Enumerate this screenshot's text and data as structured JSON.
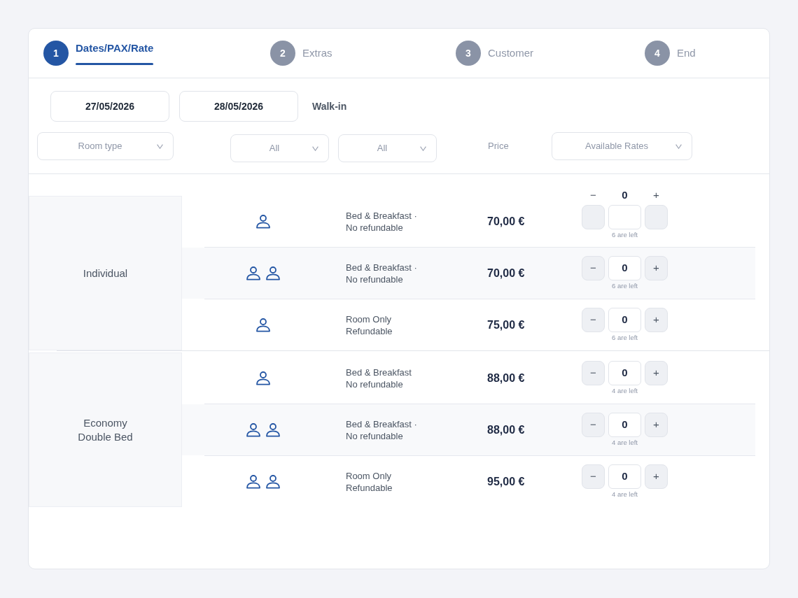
{
  "steps": [
    {
      "number": "1",
      "label": "Dates/PAX/Rate",
      "selected": true
    },
    {
      "number": "2",
      "label": "Extras",
      "selected": false
    },
    {
      "number": "3",
      "label": "Customer",
      "selected": false
    },
    {
      "number": "4",
      "label": "End",
      "selected": false
    }
  ],
  "search": {
    "arrival": "27/05/2026",
    "departure": "28/05/2026",
    "booking_type": "Walk-in",
    "room_type_dropdown": "Room type",
    "dropdown_2": "All",
    "dropdown_3": "All",
    "price_heading": "Price",
    "rates_dropdown": "Available Rates"
  },
  "room_types": [
    {
      "name": "Individual",
      "rates": [
        {
          "kind": "single",
          "meal": "Bed & Breakfast ·",
          "policy": "No refundable",
          "price": "70,00 €",
          "counter": {
            "kind": "split",
            "minus": "−",
            "value": "0",
            "plus": "+",
            "note": "6 are left"
          }
        },
        {
          "kind": "double",
          "meal": "Bed & Breakfast ·",
          "policy": "No refundable",
          "price": "70,00 €",
          "counter": {
            "kind": "inline",
            "minus": "−",
            "value": "0",
            "plus": "+",
            "note": "6 are left"
          }
        },
        {
          "kind": "single",
          "meal": "Room Only",
          "policy": "Refundable",
          "price": "75,00 €",
          "counter": {
            "kind": "inline",
            "minus": "−",
            "value": "0",
            "plus": "+",
            "note": "6 are left"
          }
        }
      ]
    },
    {
      "name": "Economy Double Bed",
      "rates": [
        {
          "kind": "single",
          "meal": "Bed & Breakfast",
          "policy": "No refundable",
          "price": "88,00 €",
          "counter": {
            "kind": "inline",
            "minus": "−",
            "value": "0",
            "plus": "+",
            "note": "4 are left"
          }
        },
        {
          "kind": "double",
          "meal": "Bed & Breakfast ·",
          "policy": "No refundable",
          "price": "88,00 €",
          "counter": {
            "kind": "inline",
            "minus": "−",
            "value": "0",
            "plus": "+",
            "note": "4 are left"
          }
        },
        {
          "kind": "double",
          "meal": "Room Only",
          "policy": "Refundable",
          "price": "95,00 €",
          "counter": {
            "kind": "inline",
            "minus": "−",
            "value": "0",
            "plus": "+",
            "note": "4 are left"
          }
        }
      ]
    }
  ]
}
